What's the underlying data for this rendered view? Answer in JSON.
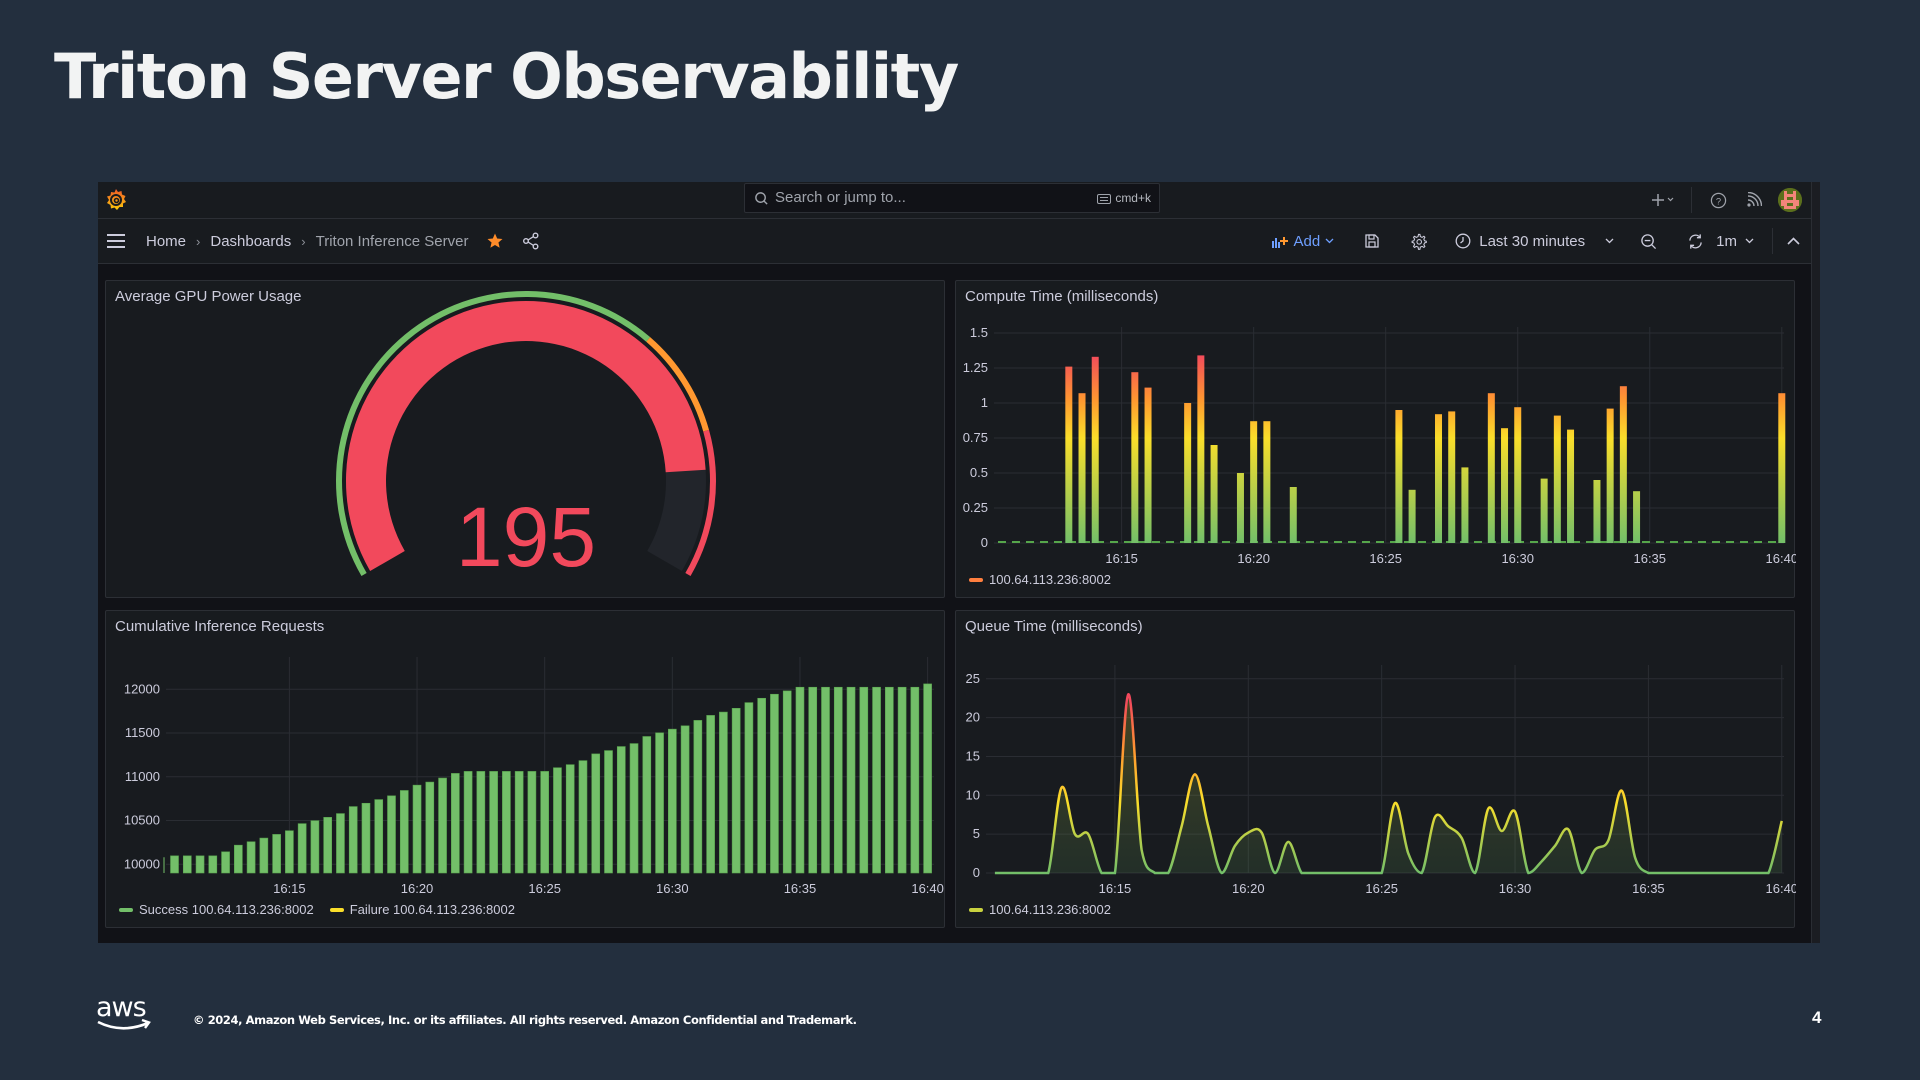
{
  "slide": {
    "title": "Triton Server Observability",
    "footer": "© 2024, Amazon Web Services, Inc. or its affiliates. All rights reserved. Amazon Confidential and Trademark.",
    "page_number": "4",
    "logo_text": "aws"
  },
  "grafana": {
    "topbar": {
      "search_placeholder": "Search or jump to...",
      "search_shortcut": "cmd+k",
      "icons": [
        "grafana-logo-icon",
        "plus-icon",
        "help-icon",
        "rss-icon",
        "avatar"
      ]
    },
    "breadcrumb": [
      {
        "label": "Home"
      },
      {
        "label": "Dashboards"
      },
      {
        "label": "Triton Inference Server"
      }
    ],
    "toolbar": {
      "add_label": "Add",
      "time_range": "Last 30 minutes",
      "refresh_interval": "1m",
      "starred": true
    },
    "colors": {
      "green": "#73bf69",
      "yellow": "#fade2a",
      "orange": "#ff9830",
      "red": "#f2495c",
      "blue_link": "#6e9fff",
      "star": "#ff8c2a"
    }
  },
  "panels": {
    "gauge": {
      "title": "Average GPU Power Usage",
      "value": "195",
      "fill_fraction": 0.86,
      "thresholds": [
        {
          "color": "green",
          "from_fraction": 0.0
        },
        {
          "color": "orange",
          "from_fraction": 0.67
        },
        {
          "color": "red",
          "from_fraction": 0.81
        }
      ]
    },
    "compute": {
      "title": "Compute Time (milliseconds)",
      "legend": [
        {
          "label": "100.64.113.236:8002",
          "color": "#ff7f3f"
        }
      ]
    },
    "cumulative": {
      "title": "Cumulative Inference Requests",
      "legend": [
        {
          "label": "Success 100.64.113.236:8002",
          "color": "#73bf69"
        },
        {
          "label": "Failure 100.64.113.236:8002",
          "color": "#fade2a"
        }
      ]
    },
    "queue": {
      "title": "Queue Time (milliseconds)",
      "legend": [
        {
          "label": "100.64.113.236:8002",
          "color": "#c8d13f"
        }
      ]
    }
  },
  "chart_data": [
    {
      "id": "compute",
      "type": "bar",
      "title": "Compute Time (milliseconds)",
      "xlabel": "",
      "ylabel": "",
      "x_range": [
        "16:10:10",
        "16:40:05"
      ],
      "ylim": [
        0,
        1.5
      ],
      "yticks": [
        "0",
        "0.25",
        "0.5",
        "0.75",
        "1",
        "1.25",
        "1.5"
      ],
      "xticks": [
        "16:15",
        "16:20",
        "16:25",
        "16:30",
        "16:35",
        "16:40"
      ],
      "grid": true,
      "legend_position": "bottom-left",
      "series": [
        {
          "name": "100.64.113.236:8002",
          "points": [
            [
              "16:13:00",
              1.26
            ],
            [
              "16:13:30",
              1.07
            ],
            [
              "16:14:00",
              1.33
            ],
            [
              "16:15:30",
              1.22
            ],
            [
              "16:16:00",
              1.11
            ],
            [
              "16:17:30",
              1.0
            ],
            [
              "16:18:00",
              1.34
            ],
            [
              "16:18:30",
              0.7
            ],
            [
              "16:19:30",
              0.5
            ],
            [
              "16:20:00",
              0.87
            ],
            [
              "16:20:30",
              0.87
            ],
            [
              "16:21:30",
              0.4
            ],
            [
              "16:25:30",
              0.95
            ],
            [
              "16:26:00",
              0.38
            ],
            [
              "16:27:00",
              0.92
            ],
            [
              "16:27:30",
              0.94
            ],
            [
              "16:28:00",
              0.54
            ],
            [
              "16:29:00",
              1.07
            ],
            [
              "16:29:30",
              0.82
            ],
            [
              "16:30:00",
              0.97
            ],
            [
              "16:31:00",
              0.46
            ],
            [
              "16:31:30",
              0.91
            ],
            [
              "16:32:00",
              0.81
            ],
            [
              "16:33:00",
              0.45
            ],
            [
              "16:33:30",
              0.96
            ],
            [
              "16:34:00",
              1.12
            ],
            [
              "16:34:30",
              0.37
            ],
            [
              "16:40:00",
              1.07
            ]
          ]
        }
      ]
    },
    {
      "id": "cumulative",
      "type": "bar",
      "title": "Cumulative Inference Requests",
      "xlabel": "",
      "ylabel": "",
      "x_start": "16:10:30",
      "x_step_seconds": 30,
      "x_range": [
        "16:10:10",
        "16:40:15"
      ],
      "ylim": [
        9900,
        12300
      ],
      "yticks": [
        "10000",
        "10500",
        "11000",
        "11500",
        "12000"
      ],
      "xticks": [
        "16:15",
        "16:20",
        "16:25",
        "16:30",
        "16:35",
        "16:40"
      ],
      "grid": true,
      "legend_position": "bottom-left",
      "series": [
        {
          "name": "Success 100.64.113.236:8002",
          "values": [
            10096,
            10096,
            10096,
            10096,
            10142,
            10218,
            10257,
            10299,
            10341,
            10383,
            10464,
            10498,
            10536,
            10579,
            10659,
            10697,
            10739,
            10782,
            10843,
            10904,
            10939,
            10985,
            11038,
            11061,
            11061,
            11061,
            11061,
            11061,
            11061,
            11061,
            11103,
            11138,
            11184,
            11261,
            11299,
            11345,
            11379,
            11460,
            11502,
            11544,
            11582,
            11644,
            11701,
            11739,
            11782,
            11847,
            11897,
            11943,
            11981,
            12023,
            12023,
            12023,
            12023,
            12023,
            12023,
            12023,
            12023,
            12023,
            12023,
            12061
          ]
        },
        {
          "name": "Failure 100.64.113.236:8002",
          "values": []
        }
      ]
    },
    {
      "id": "queue",
      "type": "area",
      "title": "Queue Time (milliseconds)",
      "xlabel": "",
      "ylabel": "",
      "x_start": "16:10:00",
      "x_step_seconds": 30,
      "x_range": [
        "16:10:10",
        "16:40:05"
      ],
      "ylim": [
        0,
        26
      ],
      "yticks": [
        "0",
        "5",
        "10",
        "15",
        "20",
        "25"
      ],
      "xticks": [
        "16:15",
        "16:20",
        "16:25",
        "16:30",
        "16:35",
        "16:40"
      ],
      "grid": true,
      "legend_position": "bottom-left",
      "series": [
        {
          "name": "100.64.113.236:8002",
          "values": [
            0,
            0,
            0,
            0,
            0,
            0,
            11,
            5,
            5,
            0,
            0,
            23,
            3,
            0,
            0,
            6,
            12.7,
            6,
            0,
            3.5,
            5.2,
            5.2,
            0,
            4,
            0,
            0,
            0,
            0,
            0,
            0,
            0,
            9,
            2.5,
            0,
            7.2,
            6,
            4.5,
            0,
            8.3,
            5.4,
            7.9,
            0,
            1.5,
            3.5,
            5.6,
            0,
            3,
            4.2,
            10.6,
            2,
            0,
            0,
            0,
            0,
            0,
            0,
            0,
            0,
            0,
            0,
            6.7
          ]
        }
      ]
    }
  ]
}
